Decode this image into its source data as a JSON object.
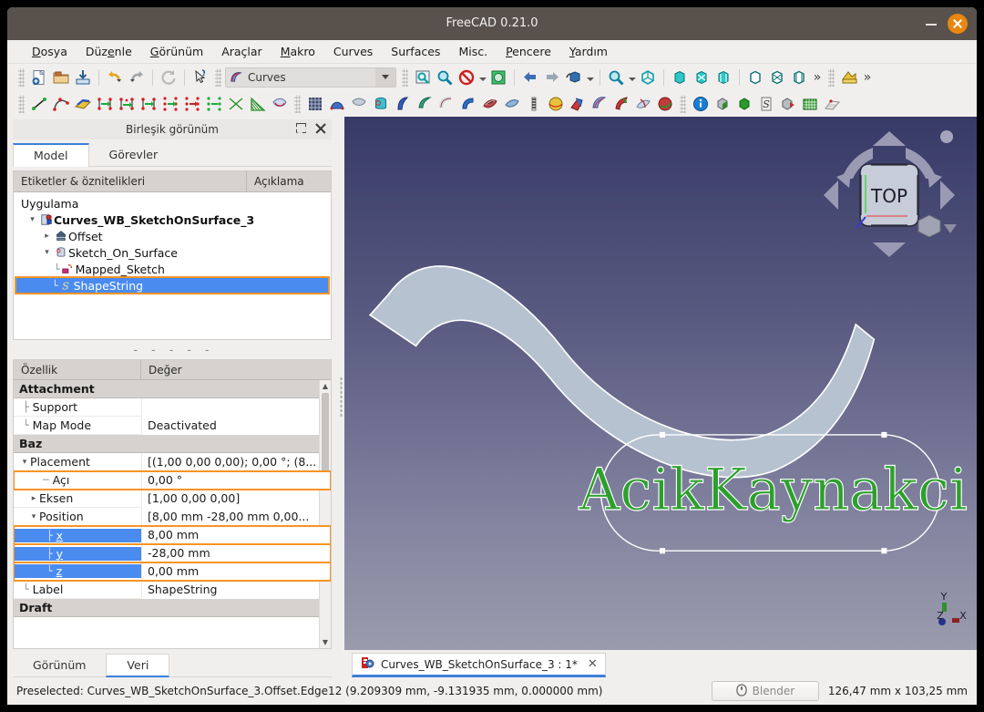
{
  "window": {
    "title": "FreeCAD 0.21.0",
    "minimize_label": "minimize",
    "close_label": "close"
  },
  "menu": {
    "items": [
      {
        "label": "Dosya",
        "accel": "D"
      },
      {
        "label": "Düzenle",
        "accel": "z"
      },
      {
        "label": "Görünüm",
        "accel": "G"
      },
      {
        "label": "Araçlar",
        "accel": ""
      },
      {
        "label": "Makro",
        "accel": "M"
      },
      {
        "label": "Curves",
        "accel": ""
      },
      {
        "label": "Surfaces",
        "accel": ""
      },
      {
        "label": "Misc.",
        "accel": ""
      },
      {
        "label": "Pencere",
        "accel": "P"
      },
      {
        "label": "Yardım",
        "accel": "Y"
      }
    ]
  },
  "toolbar": {
    "workbench_selected": "Curves",
    "row1_icons": [
      "new-document-icon",
      "open-folder-icon",
      "save-icon",
      "undo-icon",
      "redo-icon",
      "refresh-icon",
      "whats-this-icon"
    ],
    "row1b_icons": [
      "fit-all-icon",
      "zoom-fit-selection-icon",
      "draw-style-icon",
      "std-view-box-icon",
      "back-arrow-icon",
      "forward-arrow-icon",
      "axonometric-icon",
      "zoom-icon",
      "view-isometric-icon",
      "view-front-icon",
      "view-top-icon",
      "view-right-icon",
      "view-rear-icon",
      "view-bottom-icon",
      "view-left-icon"
    ],
    "overflow_label": "»"
  },
  "left_panel": {
    "header_title": "Birleşik görünüm",
    "tabs": [
      {
        "label": "Model",
        "active": true
      },
      {
        "label": "Görevler",
        "active": false
      }
    ],
    "tree": {
      "columns": [
        "Etiketler & öznitelikleri",
        "Açıklama"
      ],
      "rows": [
        {
          "label": "Uygulama",
          "depth": 0,
          "bold": false,
          "twist": "",
          "icon": "",
          "selected": false
        },
        {
          "label": "Curves_WB_SketchOnSurface_3",
          "depth": 1,
          "bold": true,
          "twist": "v",
          "icon": "document-icon",
          "selected": false
        },
        {
          "label": "Offset",
          "depth": 2,
          "bold": false,
          "twist": ">",
          "icon": "offset-icon",
          "selected": false
        },
        {
          "label": "Sketch_On_Surface",
          "depth": 2,
          "bold": false,
          "twist": "v",
          "icon": "sketch-surface-icon",
          "selected": false
        },
        {
          "label": "Mapped_Sketch",
          "depth": 3,
          "bold": false,
          "twist": "",
          "icon": "mapped-sketch-icon",
          "selected": false
        },
        {
          "label": "ShapeString",
          "depth": 2,
          "bold": false,
          "twist": "",
          "icon": "shapestring-icon",
          "selected": true
        }
      ]
    },
    "separator_dashes": "- - - - -",
    "properties": {
      "columns": [
        "Özellik",
        "Değer"
      ],
      "rows": [
        {
          "type": "group",
          "name": "Attachment",
          "value": ""
        },
        {
          "type": "item",
          "name": "Support",
          "value": "",
          "depth": 1,
          "expander": "",
          "highlight": false,
          "selected": false
        },
        {
          "type": "item",
          "name": "Map Mode",
          "value": "Deactivated",
          "depth": 1,
          "expander": "",
          "highlight": false,
          "selected": false
        },
        {
          "type": "group",
          "name": "Baz",
          "value": ""
        },
        {
          "type": "item",
          "name": "Placement",
          "value": "[(1,00 0,00 0,00); 0,00 °; (8...",
          "depth": 0,
          "expander": "v",
          "highlight": false,
          "selected": false
        },
        {
          "type": "item",
          "name": "Açı",
          "value": "0,00 °",
          "depth": 2,
          "expander": "",
          "highlight": true,
          "selected": false
        },
        {
          "type": "item",
          "name": "Eksen",
          "value": "[1,00 0,00 0,00]",
          "depth": 1,
          "expander": ">",
          "highlight": false,
          "selected": false
        },
        {
          "type": "item",
          "name": "Position",
          "value": "[8,00 mm  -28,00 mm  0,00...",
          "depth": 1,
          "expander": "v",
          "highlight": false,
          "selected": false
        },
        {
          "type": "item",
          "name": "x",
          "value": "8,00 mm",
          "depth": 3,
          "expander": "",
          "highlight": true,
          "selected": true
        },
        {
          "type": "item",
          "name": "y",
          "value": "-28,00 mm",
          "depth": 3,
          "expander": "",
          "highlight": true,
          "selected": true
        },
        {
          "type": "item",
          "name": "z",
          "value": "0,00 mm",
          "depth": 3,
          "expander": "",
          "highlight": true,
          "selected": true
        },
        {
          "type": "item",
          "name": "Label",
          "value": "ShapeString",
          "depth": 1,
          "expander": "",
          "highlight": false,
          "selected": false
        },
        {
          "type": "group",
          "name": "Draft",
          "value": ""
        }
      ]
    },
    "bottom_tabs": [
      {
        "label": "Görünüm",
        "active": false
      },
      {
        "label": "Veri",
        "active": true
      }
    ]
  },
  "viewport": {
    "nav_cube_label": "TOP",
    "shape_text": "AcikKaynakci",
    "shape_text_color": "#2ca02c",
    "axis_labels": {
      "x": "X",
      "y": "Y",
      "z": "Z"
    },
    "axis_colors": {
      "x": "#8b2020",
      "y": "#2f8f2f",
      "z": "#26318c"
    },
    "background_top": "#373a66",
    "background_bottom": "#9b9bad",
    "ribbon_color": "#b6c2d0"
  },
  "document_tabs": [
    {
      "label": "Curves_WB_SketchOnSurface_3 : 1*",
      "close": "✕",
      "active": true
    }
  ],
  "statusbar": {
    "message": "Preselected: Curves_WB_SketchOnSurface_3.Offset.Edge12 (9.209309 mm, -9.131935 mm, 0.000000 mm)",
    "nav_button": "Blender",
    "dimensions": "126,47 mm x 103,25 mm"
  }
}
